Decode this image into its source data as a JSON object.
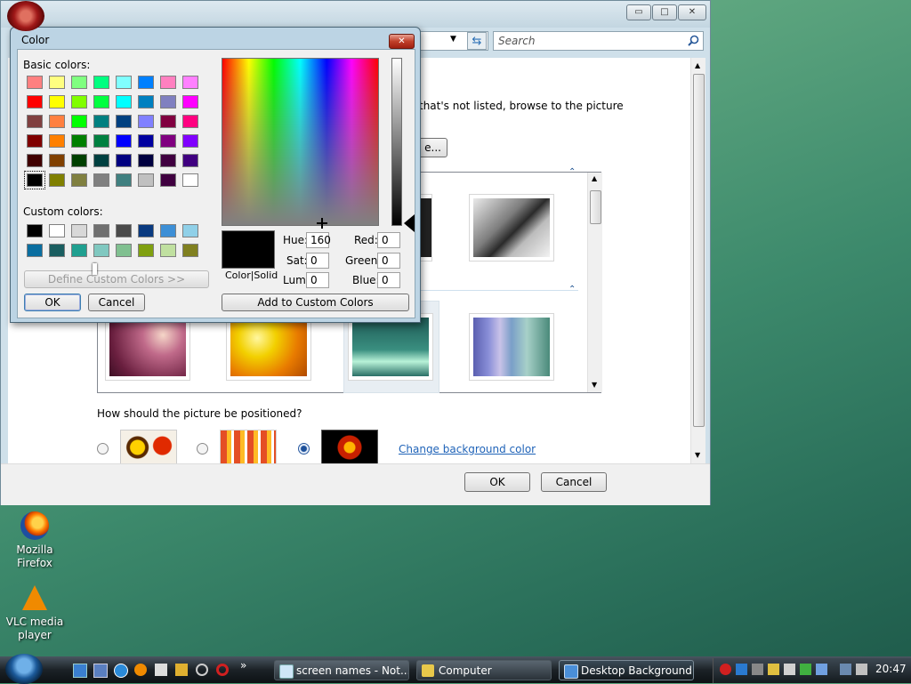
{
  "background_window": {
    "search_placeholder": "Search",
    "minimize_glyph": "▭",
    "maximize_glyph": "□",
    "close_glyph": "✕",
    "back_glyph": "⇆",
    "dropdown_glyph": "▼",
    "instruction_partial": "that's not listed, browse to the picture",
    "browse_button_partial": "e...",
    "position_question": "How should the picture be positioned?",
    "change_bg_link": "Change background color",
    "ok_label": "OK",
    "cancel_label": "Cancel"
  },
  "color_dialog": {
    "title": "Color",
    "close_glyph": "✕",
    "basic_colors_label": "Basic colors:",
    "custom_colors_label": "Custom colors:",
    "define_custom_label": "Define Custom Colors >>",
    "ok_label": "OK",
    "cancel_label": "Cancel",
    "color_solid_label": "Color|Solid",
    "add_custom_label": "Add to Custom Colors",
    "fields": {
      "hue_label": "Hue:",
      "hue_value": "160",
      "sat_label": "Sat:",
      "sat_value": "0",
      "lum_label": "Lum:",
      "lum_value": "0",
      "red_label": "Red:",
      "red_value": "0",
      "green_label": "Green:",
      "green_value": "0",
      "blue_label": "Blue:",
      "blue_value": "0"
    },
    "basic_colors": [
      [
        "#ff8080",
        "#ffff80",
        "#80ff80",
        "#00ff80",
        "#80ffff",
        "#0080ff",
        "#ff80c0",
        "#ff80ff"
      ],
      [
        "#ff0000",
        "#ffff00",
        "#80ff00",
        "#00ff40",
        "#00ffff",
        "#0080c0",
        "#8080c0",
        "#ff00ff"
      ],
      [
        "#804040",
        "#ff8040",
        "#00ff00",
        "#008080",
        "#004080",
        "#8080ff",
        "#800040",
        "#ff0080"
      ],
      [
        "#800000",
        "#ff8000",
        "#008000",
        "#008040",
        "#0000ff",
        "#0000a0",
        "#800080",
        "#8000ff"
      ],
      [
        "#400000",
        "#804000",
        "#004000",
        "#004040",
        "#000080",
        "#000040",
        "#400040",
        "#400080"
      ],
      [
        "#000000",
        "#808000",
        "#808040",
        "#808080",
        "#408080",
        "#c0c0c0",
        "#400040",
        "#ffffff"
      ]
    ],
    "custom_colors": [
      [
        "#000000",
        "#ffffff",
        "#d8d8d8",
        "#707070",
        "#4a4a4a",
        "#0a3a80",
        "#3d8fd6",
        "#90d0e8"
      ],
      [
        "#0a6ea0",
        "#1a5e60",
        "#20a090",
        "#80c8c0",
        "#80c090",
        "#80a010",
        "#c0e0a0",
        "#808020"
      ]
    ]
  },
  "desktop_icons": [
    {
      "label_line1": "Mozilla",
      "label_line2": "Firefox"
    },
    {
      "label_line1": "VLC media",
      "label_line2": "player"
    }
  ],
  "taskbar": {
    "items": [
      "screen names - Not...",
      "Computer",
      "Desktop Background"
    ],
    "chevron": "»",
    "clock": "20:47"
  }
}
